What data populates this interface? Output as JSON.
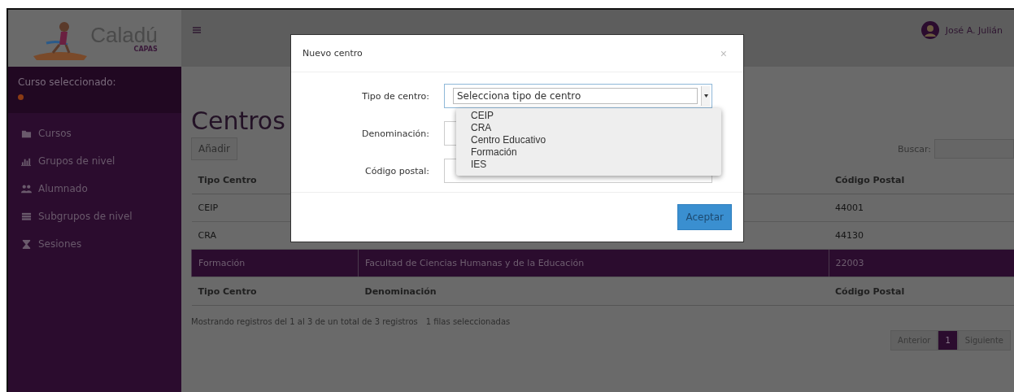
{
  "header": {
    "logo": {
      "name": "Caladú",
      "subtitle": "CAPAS"
    },
    "user": "José A. Julián"
  },
  "sidebar": {
    "course_label": "Curso seleccionado:",
    "items": [
      {
        "label": "Cursos"
      },
      {
        "label": "Grupos de nivel"
      },
      {
        "label": "Alumnado"
      },
      {
        "label": "Subgrupos de nivel"
      },
      {
        "label": "Sesiones"
      }
    ]
  },
  "page": {
    "title": "Centros",
    "add_button": "Añadir",
    "search_label": "Buscar:"
  },
  "table": {
    "columns": [
      "Tipo Centro",
      "Código Postal"
    ],
    "rows": [
      {
        "tipo_centro": "CEIP",
        "codigo_postal": "44001",
        "selected": false
      },
      {
        "tipo_centro": "CRA",
        "codigo_postal": "44130",
        "selected": false
      },
      {
        "tipo_centro": "Formación",
        "denominacion": "Facultad de Ciencias Humanas y de la Educación",
        "codigo_postal": "22003",
        "selected": true
      }
    ],
    "footer_columns": [
      "Tipo Centro",
      "Denominación",
      "Código Postal"
    ],
    "info": "Mostrando registros del 1 al 3 de un total de 3 registros",
    "selection_info": "1 filas seleccionadas"
  },
  "pagination": {
    "previous": "Anterior",
    "pages": [
      {
        "label": "1",
        "selected": true
      }
    ],
    "next": "Siguiente"
  },
  "modal": {
    "title": "Nuevo centro",
    "close": "×",
    "fields": [
      {
        "label": "Tipo de centro:",
        "kind": "select",
        "value": "Selecciona tipo de centro",
        "expanded": true,
        "options": [
          "CEIP",
          "CRA",
          "Centro Educativo",
          "Formación",
          "IES"
        ]
      },
      {
        "label": "Denominación:",
        "kind": "text"
      },
      {
        "label": "Código postal:",
        "kind": "text"
      }
    ],
    "submit": "Aceptar"
  }
}
